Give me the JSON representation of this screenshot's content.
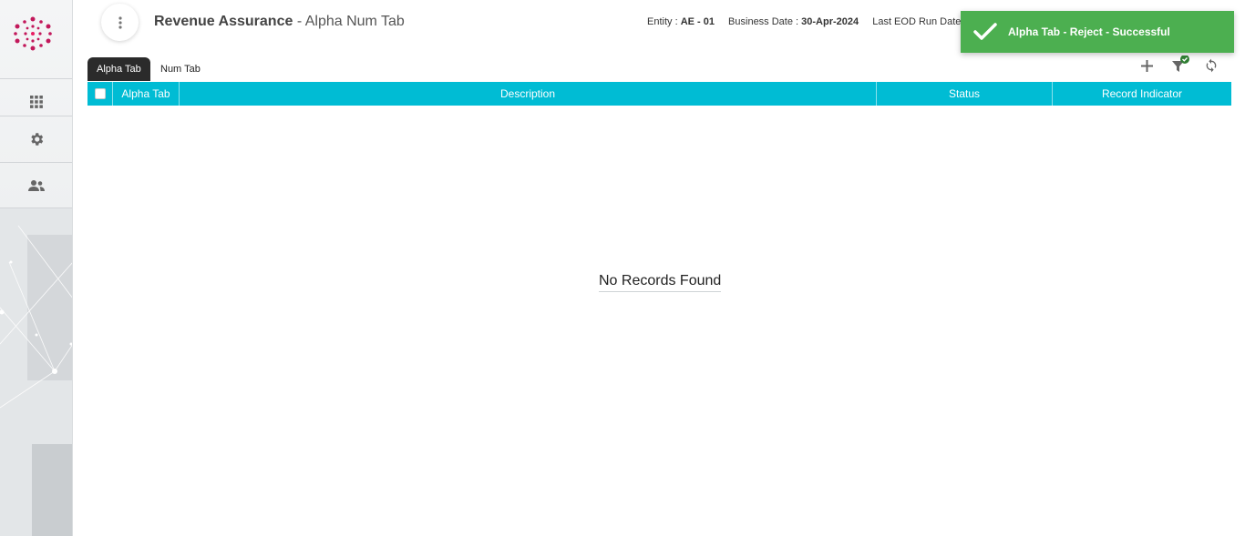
{
  "header": {
    "title_main": "Revenue Assurance",
    "title_sub": "- Alpha Num Tab",
    "entity_label": "Entity :",
    "entity_value": "AE - 01",
    "business_date_label": "Business Date :",
    "business_date_value": "30-Apr-2024",
    "last_eod_label": "Last EOD Run Date"
  },
  "toast": {
    "message": "Alpha Tab - Reject - Successful",
    "color": "#4caf50"
  },
  "tabs": [
    {
      "label": "Alpha Tab",
      "active": true
    },
    {
      "label": "Num Tab",
      "active": false
    }
  ],
  "sidebar": {
    "items": [
      {
        "icon": "apps-grid-icon"
      },
      {
        "icon": "gear-icon"
      },
      {
        "icon": "users-icon"
      }
    ]
  },
  "toolbar": {
    "icons": [
      "add-icon",
      "filter-icon",
      "refresh-icon"
    ]
  },
  "table": {
    "header_color": "#00bcd4",
    "columns": [
      "Alpha Tab",
      "Description",
      "Status",
      "Record Indicator"
    ],
    "empty_message": "No Records Found"
  }
}
